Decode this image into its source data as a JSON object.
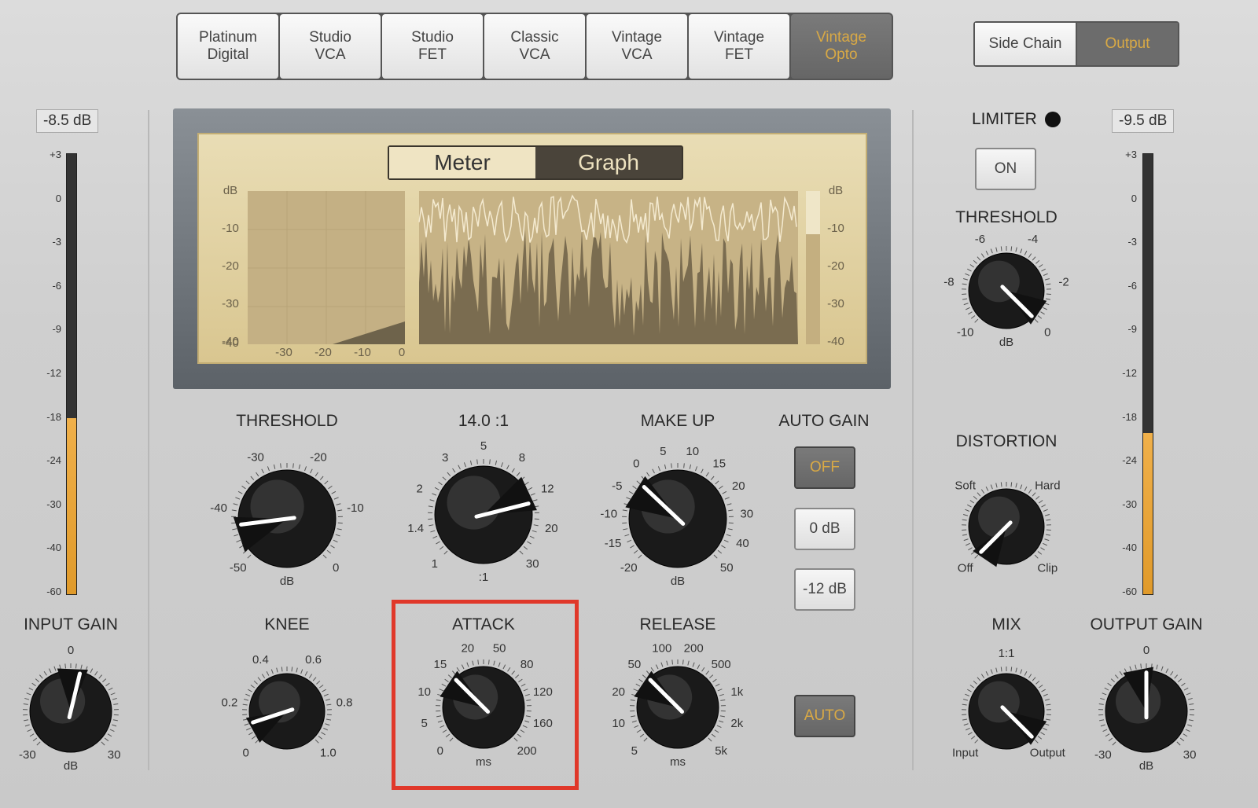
{
  "models": [
    {
      "label": "Platinum Digital",
      "l1": "Platinum",
      "l2": "Digital"
    },
    {
      "l1": "Studio",
      "l2": "VCA"
    },
    {
      "l1": "Studio",
      "l2": "FET"
    },
    {
      "l1": "Classic",
      "l2": "VCA"
    },
    {
      "l1": "Vintage",
      "l2": "VCA"
    },
    {
      "l1": "Vintage",
      "l2": "FET"
    },
    {
      "l1": "Vintage",
      "l2": "Opto",
      "active": true
    }
  ],
  "view_switch": {
    "side_chain": "Side Chain",
    "output": "Output",
    "selected": "Output"
  },
  "input_meter": {
    "readout": "-8.5 dB",
    "level_db": -18
  },
  "output_meter": {
    "readout": "-9.5 dB",
    "level_db": -20
  },
  "meter_scale": [
    "+3",
    "0",
    "-3",
    "-6",
    "-9",
    "-12",
    "-18",
    "-24",
    "-30",
    "-40",
    "-60"
  ],
  "display": {
    "meter": "Meter",
    "graph": "Graph",
    "selected": "Graph",
    "db": "dB",
    "y_ticks": [
      "-10",
      "-20",
      "-30",
      "-40"
    ],
    "x_ticks": [
      "-40",
      "-30",
      "-20",
      "-10",
      "0"
    ],
    "right_ticks": [
      "dB",
      "-10",
      "-20",
      "-30",
      "-40"
    ]
  },
  "limiter": {
    "label": "LIMITER",
    "on": "ON"
  },
  "auto_gain": {
    "label": "AUTO GAIN",
    "off": "OFF",
    "zero": "0 dB",
    "minus12": "-12 dB",
    "auto": "AUTO"
  },
  "knobs": {
    "threshold": {
      "title": "THRESHOLD",
      "unit": "dB",
      "scale": [
        "-50",
        "-40",
        "-30",
        "-20",
        "-10",
        "0"
      ],
      "value": "-43"
    },
    "ratio": {
      "title": "14.0 :1",
      "unit": ":1",
      "scale": [
        "1",
        "1.4",
        "2",
        "3",
        "5",
        "8",
        "12",
        "20",
        "30"
      ],
      "value": "14"
    },
    "makeup": {
      "title": "MAKE UP",
      "unit": "dB",
      "scale": [
        "-20",
        "-15",
        "-10",
        "-5",
        "0",
        "5",
        "10",
        "15",
        "20",
        "30",
        "40",
        "50"
      ],
      "value": "-2"
    },
    "knee": {
      "title": "KNEE",
      "unit": "",
      "scale": [
        "0",
        "0.2",
        "0.4",
        "0.6",
        "0.8",
        "1.0"
      ],
      "value": "0.1"
    },
    "attack": {
      "title": "ATTACK",
      "unit": "ms",
      "scale": [
        "0",
        "5",
        "10",
        "15",
        "20",
        "50",
        "80",
        "120",
        "160",
        "200"
      ],
      "value": "15"
    },
    "release": {
      "title": "RELEASE",
      "unit": "ms",
      "scale": [
        "5",
        "10",
        "20",
        "50",
        "100",
        "200",
        "500",
        "1k",
        "2k",
        "5k"
      ],
      "value": "50"
    },
    "input_gain": {
      "title": "INPUT GAIN",
      "unit": "dB",
      "scale": [
        "-30",
        "0",
        "30"
      ],
      "value": "3"
    },
    "output_gain": {
      "title": "OUTPUT GAIN",
      "unit": "dB",
      "scale": [
        "-30",
        "0",
        "30"
      ],
      "value": "0"
    },
    "limiter_threshold": {
      "title": "THRESHOLD",
      "unit": "dB",
      "scale": [
        "-10",
        "-8",
        "-6",
        "-4",
        "-2",
        "0"
      ],
      "value": "0"
    },
    "distortion": {
      "title": "DISTORTION",
      "unit": "",
      "scale": [
        "Off",
        "Soft",
        "Hard",
        "Clip"
      ],
      "value": "Off"
    },
    "mix": {
      "title": "MIX",
      "unit": "",
      "scale": [
        "Input",
        "1:1",
        "Output"
      ],
      "value": "Output"
    }
  },
  "colors": {
    "accent": "#d9a945",
    "highlight": "#e0382a",
    "meter_fill": "#e8a53a"
  }
}
